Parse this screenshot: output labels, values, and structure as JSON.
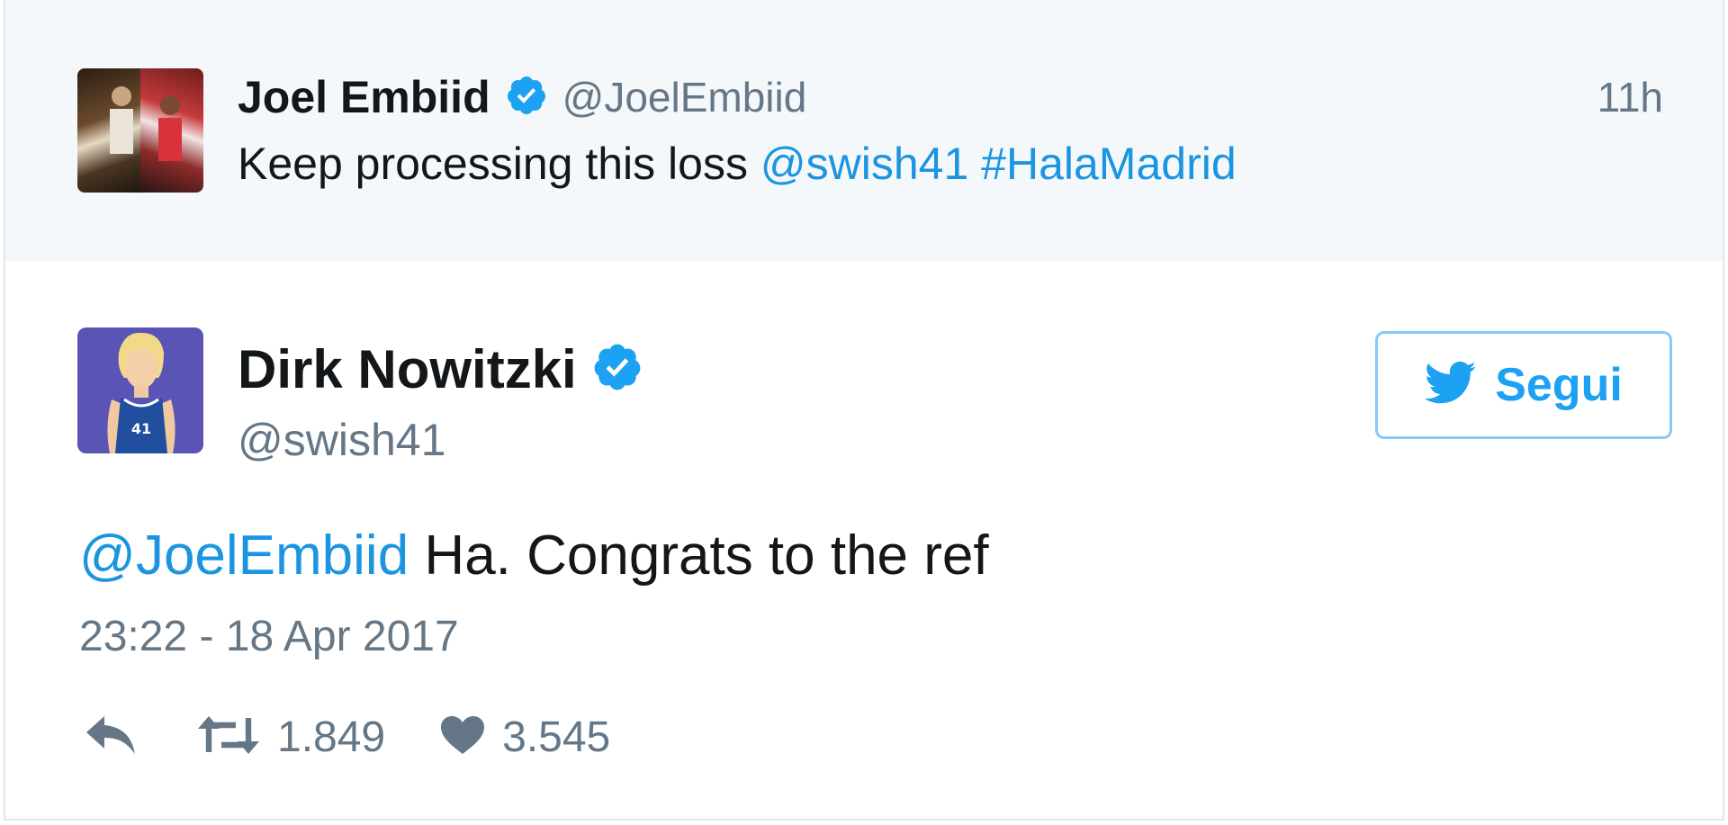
{
  "parent_tweet": {
    "author_name": "Joel Embiid",
    "author_handle": "@JoelEmbiid",
    "timestamp": "11h",
    "text_plain": "Keep processing this loss ",
    "mention": "@swish41",
    "hashtag": "#HalaMadrid"
  },
  "main_tweet": {
    "author_name": "Dirk Nowitzki",
    "author_handle": "@swish41",
    "follow_label": "Segui",
    "mention": "@JoelEmbiid",
    "text_plain": " Ha. Congrats to the ref",
    "date": "23:22 - 18 Apr 2017",
    "retweet_count": "1.849",
    "like_count": "3.545"
  },
  "colors": {
    "link": "#1b95e0",
    "verified": "#1da1f2",
    "parent_bg": "#f5f8fa",
    "muted": "#657786"
  },
  "icons": {
    "verified": "verified-badge-icon",
    "follow": "twitter-bird-icon",
    "reply": "reply-icon",
    "retweet": "retweet-icon",
    "like": "heart-icon"
  }
}
